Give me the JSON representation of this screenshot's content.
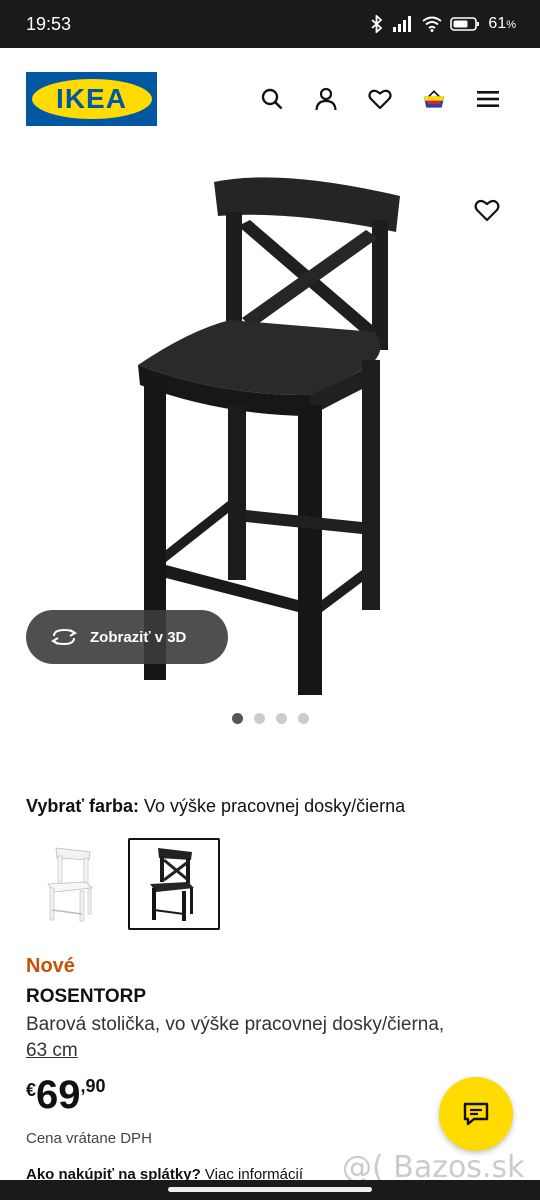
{
  "statusbar": {
    "time": "19:53",
    "battery": "61",
    "battery_unit": "%"
  },
  "header": {
    "logo_text": "IKEA",
    "icons": [
      "search-icon",
      "user-icon",
      "heart-icon",
      "cart-icon",
      "menu-icon"
    ]
  },
  "gallery": {
    "view3d_label": "Zobraziť v 3D",
    "dots": 4,
    "active_dot": 0
  },
  "color": {
    "label": "Vybrať farba:",
    "value": "Vo výške pracovnej dosky/čierna",
    "swatches": [
      "white",
      "black"
    ],
    "selected": 1
  },
  "product": {
    "badge": "Nové",
    "name": "ROSENTORP",
    "description": "Barová stolička, vo výške pracovnej dosky/čierna,",
    "size_link": "63 cm",
    "currency": "€",
    "price_main": "69",
    "price_dec": ",90",
    "vat_note": "Cena vrátane DPH",
    "loan_question": "Ako nakúpiť na splátky?",
    "loan_link": "Viac informácií"
  },
  "watermark": "@( Bazos.sk",
  "colors": {
    "ikea_blue": "#0058a3",
    "ikea_yellow": "#ffdb00",
    "new_orange": "#ca5008"
  }
}
